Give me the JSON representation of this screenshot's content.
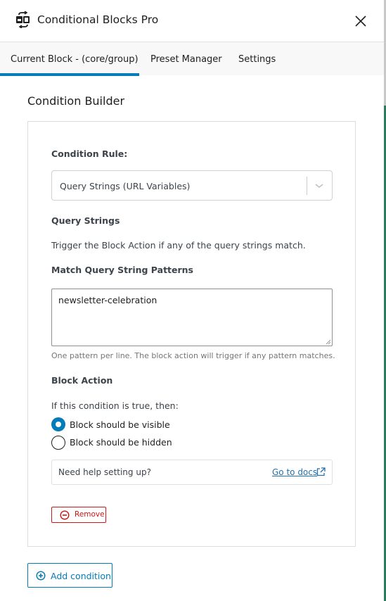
{
  "header": {
    "title": "Conditional Blocks Pro",
    "logo_icon": "conditional-blocks-logo-icon",
    "close_icon": "close-icon"
  },
  "tabs": [
    {
      "label": "Current Block - (core/group)",
      "active": true
    },
    {
      "label": "Preset Manager",
      "active": false
    },
    {
      "label": "Settings",
      "active": false
    }
  ],
  "colors": {
    "accent": "#007cba",
    "danger": "#cc1818",
    "link": "#2271b1"
  },
  "builder": {
    "title": "Condition Builder",
    "rule_label": "Condition Rule:",
    "rule_value": "Query Strings (URL Variables)",
    "section_title": "Query Strings",
    "description": "Trigger the Block Action if any of the query strings match.",
    "patterns_label": "Match Query String Patterns",
    "patterns_value": "newsletter-celebration",
    "patterns_help": "One pattern per line. The block action will trigger if any pattern matches.",
    "action_label": "Block Action",
    "action_intro": "If this condition is true, then:",
    "options": [
      {
        "label": "Block should be visible",
        "checked": true
      },
      {
        "label": "Block should be hidden",
        "checked": false
      }
    ],
    "help_question": "Need help setting up?",
    "docs_link": "Go to docs",
    "remove_label": "Remove"
  },
  "add_condition_label": "Add condition"
}
